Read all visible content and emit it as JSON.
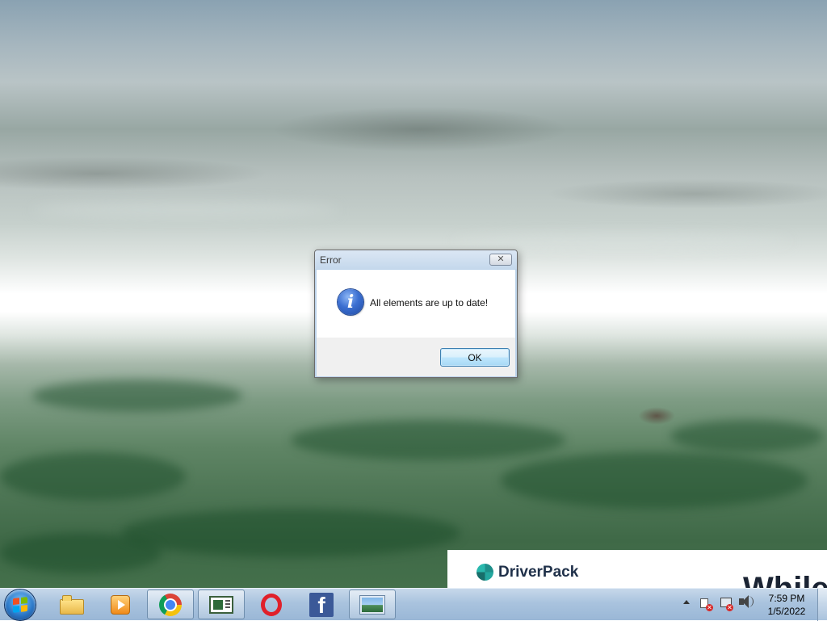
{
  "dialog": {
    "title": "Error",
    "close_label": "✕",
    "message": "All elements are up to date!",
    "ok_label": "OK",
    "icon": "info-icon"
  },
  "banner": {
    "brand": "DriverPack",
    "partial_text": "While"
  },
  "taskbar": {
    "start_icon": "windows-start-icon",
    "pinned": [
      {
        "name": "explorer-icon"
      },
      {
        "name": "media-player-icon"
      },
      {
        "name": "chrome-icon"
      },
      {
        "name": "app-window-icon"
      },
      {
        "name": "opera-icon"
      },
      {
        "name": "facebook-icon",
        "glyph": "f"
      },
      {
        "name": "photo-viewer-icon"
      }
    ],
    "tray": {
      "flag_x": "✕",
      "network_x": "✕"
    },
    "clock": {
      "time": "7:59 PM",
      "date": "1/5/2022"
    }
  },
  "colors": {
    "taskbar_top": "#c7d8ea",
    "dialog_frame": "#bcd3ea",
    "ok_button_border": "#3c7fb1",
    "brand_text": "#20314a"
  }
}
